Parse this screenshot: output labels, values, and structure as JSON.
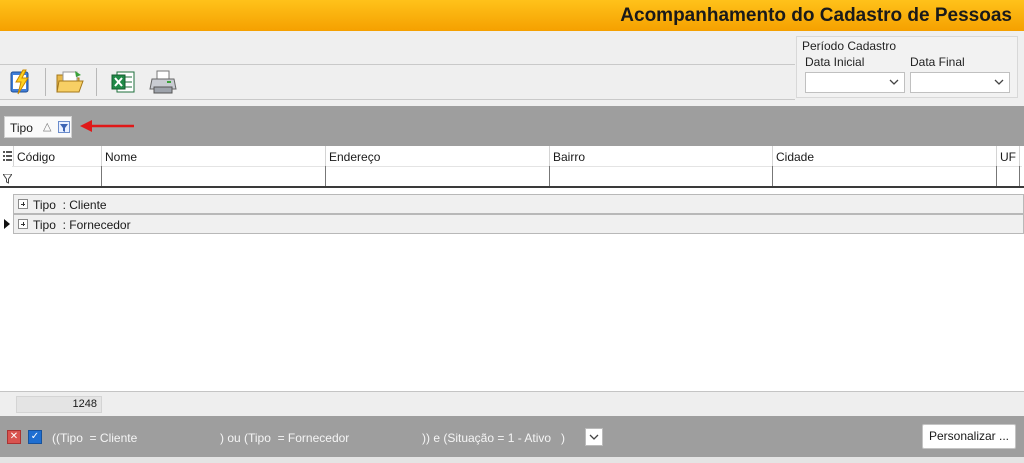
{
  "window": {
    "title": "Acompanhamento do Cadastro de Pessoas"
  },
  "toolbar": {
    "buttons": [
      {
        "icon": "refresh-lightning-icon"
      },
      {
        "icon": "open-folder-icon"
      },
      {
        "icon": "excel-icon"
      },
      {
        "icon": "printer-icon"
      }
    ]
  },
  "period": {
    "title": "Período Cadastro",
    "start_label": "Data Inicial",
    "end_label": "Data Final",
    "start_value": "",
    "end_value": ""
  },
  "group_panel": {
    "chip_label": "Tipo"
  },
  "grid": {
    "columns": [
      "Código",
      "Nome",
      "Endereço",
      "Bairro",
      "Cidade",
      "UF"
    ],
    "groups": [
      {
        "label": "Tipo  : Cliente"
      },
      {
        "label": "Tipo  : Fornecedor"
      }
    ]
  },
  "footer": {
    "count": "1248"
  },
  "filter": {
    "part1": "((Tipo  = Cliente",
    "part2": ") ou (Tipo  = Fornecedor",
    "part3": ")) e (Situação = 1 - Ativo   )",
    "customize_label": "Personalizar ..."
  },
  "colors": {
    "title_bar": "#f5a000",
    "panel_gray": "#9e9e9e",
    "accent_blue": "#1e6ed1"
  }
}
